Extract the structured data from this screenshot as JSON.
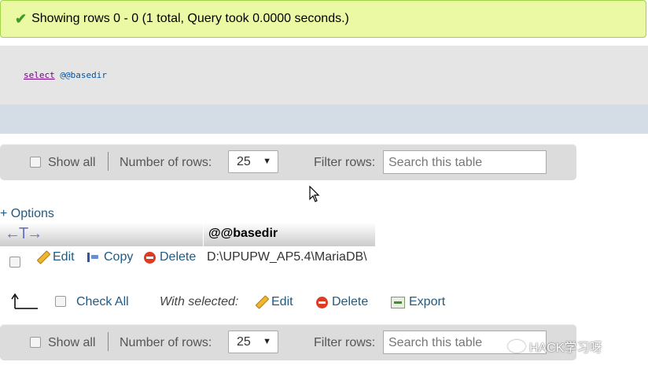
{
  "message": {
    "text": "Showing rows 0 - 0 (1 total, Query took 0.0000 seconds.)",
    "icon": "check-icon"
  },
  "sql": {
    "keyword": "select",
    "variable": "@@basedir"
  },
  "navigation": {
    "show_all": "Show all",
    "number_of_rows_label": "Number of rows:",
    "rows_value": "25",
    "filter_label": "Filter rows:",
    "search_placeholder": "Search this table"
  },
  "options_link": "+ Options",
  "table": {
    "column_header": "@@basedir",
    "row": {
      "edit": "Edit",
      "copy": "Copy",
      "delete": "Delete",
      "value": "D:\\UPUPW_AP5.4\\MariaDB\\"
    }
  },
  "bulk": {
    "check_all": "Check All",
    "with_selected": "With selected:",
    "edit": "Edit",
    "delete": "Delete",
    "export": "Export"
  },
  "watermark": "HACK学习呀",
  "colors": {
    "link": "#235a81",
    "success_bg": "#ebf8a4",
    "sql_bg": "#e5e5e5"
  }
}
